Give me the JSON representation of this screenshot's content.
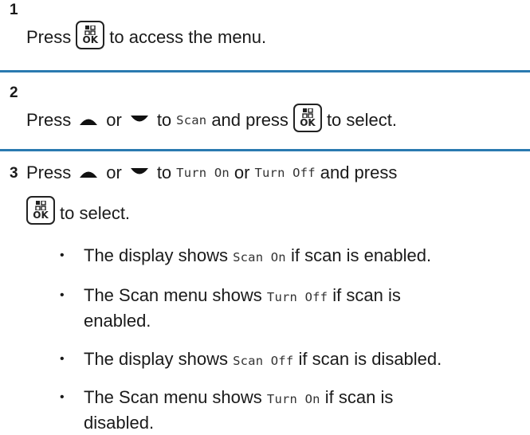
{
  "steps": [
    {
      "number": "1",
      "text_a": "Press",
      "text_b": "to access the menu."
    },
    {
      "number": "2",
      "text_a": "Press",
      "text_or": "or",
      "text_to": "to",
      "mono": "Scan",
      "text_b": "and press",
      "text_c": "to select."
    },
    {
      "number": "3",
      "text_a": "Press",
      "text_or": "or",
      "text_to": "to",
      "mono_1": "Turn On",
      "text_or2": "or",
      "mono_2": "Turn Off",
      "text_b": "and press",
      "text_c": "to select."
    }
  ],
  "ok_key": {
    "label": "OK",
    "icon": "menu-ok-key-icon"
  },
  "bullets": [
    {
      "pre": "The display shows",
      "mono": "Scan On",
      "post": "if scan is enabled."
    },
    {
      "pre": "The Scan menu shows",
      "mono": "Turn Off",
      "post": "if scan is",
      "line2": "enabled."
    },
    {
      "pre": "The display shows",
      "mono": "Scan Off",
      "post": "if scan is disabled."
    },
    {
      "pre": "The Scan menu shows",
      "mono": "Turn On",
      "post": "if scan is",
      "line2": "disabled."
    }
  ],
  "colors": {
    "separator": "#2a7ab0",
    "text": "#1a1a1a"
  }
}
